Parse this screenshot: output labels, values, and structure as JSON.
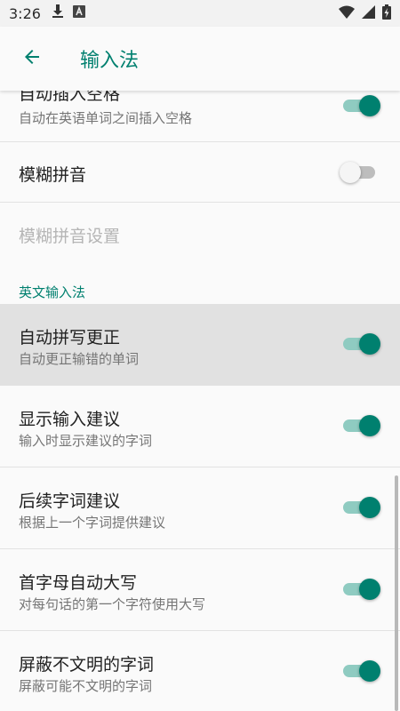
{
  "status_bar": {
    "time": "3:26",
    "left_icons": [
      "download-icon",
      "font-a-icon"
    ],
    "right_icons": [
      "wifi-icon",
      "signal-icon",
      "battery-charging-icon"
    ]
  },
  "app_bar": {
    "title": "输入法",
    "back_icon": "arrow-back-icon"
  },
  "colors": {
    "accent": "#00806f",
    "switch_track_on": "#8fcbc1",
    "pressed_row": "#e1e1e1"
  },
  "preferences": [
    {
      "id": "auto-space",
      "title": "自动插入空格",
      "summary": "自动在英语单词之间插入空格",
      "checked": true
    },
    {
      "id": "fuzzy-pinyin",
      "title": "模糊拼音",
      "checked": false
    },
    {
      "id": "fuzzy-pinyin-settings",
      "title": "模糊拼音设置",
      "disabled": true
    }
  ],
  "english_section": {
    "header": "英文输入法",
    "items": [
      {
        "id": "auto-correct",
        "title": "自动拼写更正",
        "summary": "自动更正输错的单词",
        "checked": true,
        "pressed": true
      },
      {
        "id": "show-suggestions",
        "title": "显示输入建议",
        "summary": "输入时显示建议的字词",
        "checked": true
      },
      {
        "id": "next-word",
        "title": "后续字词建议",
        "summary": "根据上一个字词提供建议",
        "checked": true
      },
      {
        "id": "auto-cap",
        "title": "首字母自动大写",
        "summary": "对每句话的第一个字符使用大写",
        "checked": true
      },
      {
        "id": "block-offensive",
        "title": "屏蔽不文明的字词",
        "summary": "屏蔽可能不文明的字词",
        "checked": true
      }
    ]
  }
}
